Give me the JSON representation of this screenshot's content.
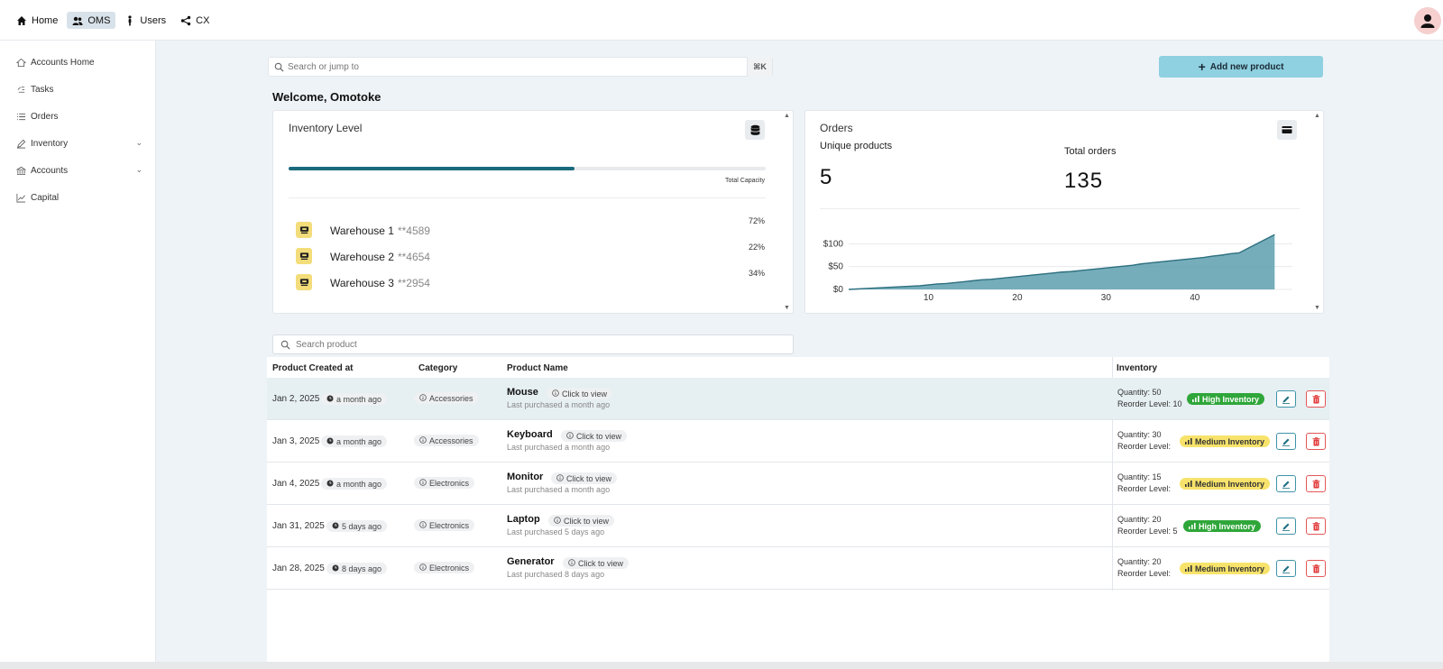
{
  "topnav": {
    "items": [
      {
        "label": "Home",
        "icon": "home-icon"
      },
      {
        "label": "OMS",
        "icon": "users-icon",
        "active": true
      },
      {
        "label": "Users",
        "icon": "person-icon"
      },
      {
        "label": "CX",
        "icon": "share-icon"
      }
    ]
  },
  "sidebar": {
    "items": [
      {
        "label": "Accounts Home",
        "icon": "home-outline-icon"
      },
      {
        "label": "Tasks",
        "icon": "tasks-icon"
      },
      {
        "label": "Orders",
        "icon": "list-icon"
      },
      {
        "label": "Inventory",
        "icon": "edit-icon",
        "expandable": true
      },
      {
        "label": "Accounts",
        "icon": "bank-icon",
        "expandable": true
      },
      {
        "label": "Capital",
        "icon": "chart-line-icon"
      }
    ]
  },
  "search": {
    "placeholder": "Search or jump to",
    "shortcut": "⌘K"
  },
  "add_button": {
    "label": "Add new product"
  },
  "welcome": "Welcome, Omotoke",
  "inventory_card": {
    "title": "Inventory Level",
    "progress": 0.6,
    "capacity_label": "Total Capacity",
    "warehouses": [
      {
        "name": "Warehouse 1",
        "code": "**4589",
        "pct": "72%"
      },
      {
        "name": "Warehouse 2",
        "code": "**4654",
        "pct": "22%"
      },
      {
        "name": "Warehouse 3",
        "code": "**2954",
        "pct": "34%"
      }
    ]
  },
  "orders_card": {
    "title": "Orders",
    "unique_label": "Unique products",
    "unique_value": "5",
    "total_label": "Total orders",
    "total_value": "135"
  },
  "chart_data": {
    "type": "area",
    "x": [
      1,
      2,
      3,
      4,
      5,
      6,
      7,
      8,
      9,
      10,
      11,
      12,
      13,
      14,
      15,
      16,
      17,
      18,
      19,
      20,
      21,
      22,
      23,
      24,
      25,
      26,
      27,
      28,
      29,
      30,
      31,
      32,
      33,
      34,
      35,
      36,
      37,
      38,
      39,
      40,
      41,
      42,
      43,
      44,
      45,
      46,
      47,
      48,
      49
    ],
    "values": [
      0,
      1,
      2,
      3,
      4,
      5,
      6,
      7,
      8,
      10,
      12,
      13,
      15,
      17,
      19,
      21,
      22,
      24,
      26,
      28,
      30,
      32,
      34,
      36,
      38,
      39,
      41,
      43,
      45,
      47,
      49,
      51,
      53,
      56,
      58,
      60,
      62,
      64,
      66,
      68,
      70,
      73,
      75,
      78,
      80,
      90,
      100,
      110,
      120
    ],
    "yticks": [
      "$0",
      "$50",
      "$100"
    ],
    "xticks": [
      "10",
      "20",
      "30",
      "40"
    ],
    "ylim": [
      0,
      150
    ],
    "xlim": [
      1,
      51
    ],
    "color": "#5d9fae",
    "grid": true
  },
  "product_search": {
    "placeholder": "Search product"
  },
  "table": {
    "headers": {
      "created": "Product Created at",
      "category": "Category",
      "name": "Product Name",
      "inventory": "Inventory"
    },
    "click_label": "Click to view",
    "rows": [
      {
        "date": "Jan 2, 2025",
        "ago": "a month ago",
        "category": "Accessories",
        "name": "Mouse",
        "last": "Last purchased a month ago",
        "qty": "Quantity: 50",
        "reorder": "Reorder Level: 10",
        "badge": "High Inventory",
        "level": "high"
      },
      {
        "date": "Jan 3, 2025",
        "ago": "a month ago",
        "category": "Accessories",
        "name": "Keyboard",
        "last": "Last purchased a month ago",
        "qty": "Quantity: 30",
        "reorder": "Reorder Level:",
        "badge": "Medium Inventory",
        "level": "med"
      },
      {
        "date": "Jan 4, 2025",
        "ago": "a month ago",
        "category": "Electronics",
        "name": "Monitor",
        "last": "Last purchased a month ago",
        "qty": "Quantity: 15",
        "reorder": "Reorder Level:",
        "badge": "Medium Inventory",
        "level": "med"
      },
      {
        "date": "Jan 31, 2025",
        "ago": "5 days ago",
        "category": "Electronics",
        "name": "Laptop",
        "last": "Last purchased 5 days ago",
        "qty": "Quantity: 20",
        "reorder": "Reorder Level: 5",
        "badge": "High Inventory",
        "level": "high"
      },
      {
        "date": "Jan 28, 2025",
        "ago": "8 days ago",
        "category": "Electronics",
        "name": "Generator",
        "last": "Last purchased 8 days ago",
        "qty": "Quantity: 20",
        "reorder": "Reorder Level:",
        "badge": "Medium Inventory",
        "level": "med"
      }
    ]
  }
}
